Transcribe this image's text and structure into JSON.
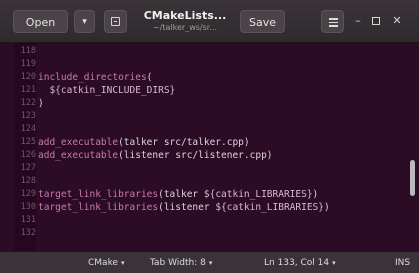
{
  "header": {
    "open_label": "Open",
    "open_dropdown_glyph": "▾",
    "title": "CMakeLists...",
    "subtitle": "~/talker_ws/sr...",
    "save_label": "Save",
    "minimize_glyph": "–",
    "close_glyph": "✕"
  },
  "editor": {
    "lines": [
      {
        "num": "118",
        "code": ""
      },
      {
        "num": "119",
        "code": ""
      },
      {
        "num": "120",
        "code": "include_directories("
      },
      {
        "num": "121",
        "code": "  ${catkin_INCLUDE_DIRS}"
      },
      {
        "num": "122",
        "code": ")"
      },
      {
        "num": "123",
        "code": ""
      },
      {
        "num": "124",
        "code": ""
      },
      {
        "num": "125",
        "code": "add_executable(talker src/talker.cpp)"
      },
      {
        "num": "126",
        "code": "add_executable(listener src/listener.cpp)"
      },
      {
        "num": "127",
        "code": ""
      },
      {
        "num": "128",
        "code": ""
      },
      {
        "num": "129",
        "code": "target_link_libraries(talker ${catkin_LIBRARIES})"
      },
      {
        "num": "130",
        "code": "target_link_libraries(listener ${catkin_LIBRARIES})"
      },
      {
        "num": "131",
        "code": ""
      },
      {
        "num": "132",
        "code": ""
      }
    ]
  },
  "statusbar": {
    "language": "CMake",
    "tab_width": "Tab Width: 8",
    "caret_glyph": "▾",
    "position": "Ln 133, Col 14",
    "mode": "INS"
  }
}
